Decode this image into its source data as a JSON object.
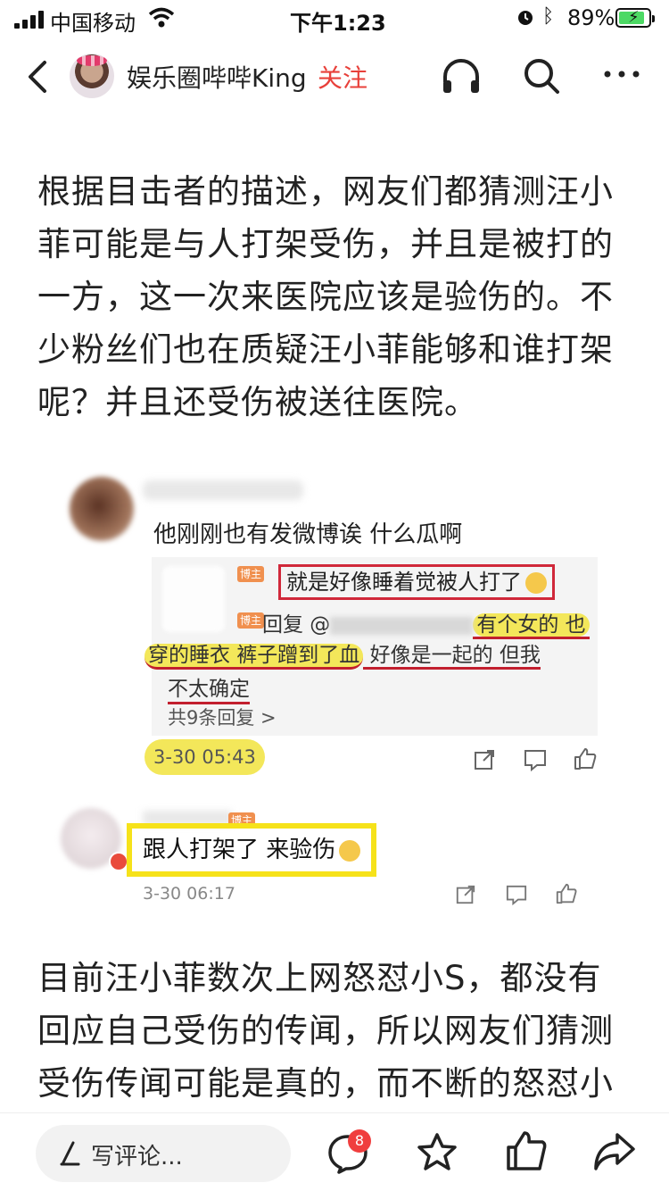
{
  "status_bar": {
    "carrier": "中国移动",
    "time": "下午1:23",
    "battery_pct": "89%"
  },
  "header": {
    "account_name": "娱乐圈哔哔King",
    "follow_label": "关注"
  },
  "article": {
    "paragraph1": "根据目击者的描述，网友们都猜测汪小菲可能是与人打架受伤，并且是被打的一方，这一次来医院应该是验伤的。不少粉丝们也在质疑汪小菲能够和谁打架呢？并且还受伤被送往医院。",
    "paragraph2": "目前汪小菲数次上网怒怼小S，都没有回应自己受伤的传闻，所以网友们猜测受伤传闻可能是真的，而不断的怒怼小S可能"
  },
  "screenshot": {
    "comment1": {
      "text": "他刚刚也有发微博诶 什么瓜啊",
      "time": "3-30 05:43"
    },
    "reply": {
      "tag": "博主",
      "line1": "就是好像睡着觉被人打了",
      "reply_prefix": "回复 @",
      "highlight1": "有个女的 也",
      "highlight2": "穿的睡衣 裤子蹭到了血",
      "line3_rest": " 好像是一起的 但我",
      "line4": "不太确定",
      "more_replies": "共9条回复 >"
    },
    "comment2": {
      "text": "跟人打架了 来验伤",
      "time": "3-30 06:17"
    }
  },
  "bottom_bar": {
    "comment_placeholder": "写评论...",
    "comment_count": "8"
  },
  "icons": [
    "signal-icon",
    "wifi-icon",
    "alarm-icon",
    "bluetooth-icon",
    "battery-icon",
    "back-icon",
    "headphones-icon",
    "search-icon",
    "more-icon",
    "pen-icon",
    "comment-icon",
    "star-icon",
    "like-icon",
    "share-icon"
  ],
  "colors": {
    "follow": "#e8403a",
    "highlight_yellow": "#f3e75a",
    "underline_red": "#c21f2e",
    "box_yellow": "#f6e21a",
    "badge_red": "#f03e3e"
  }
}
